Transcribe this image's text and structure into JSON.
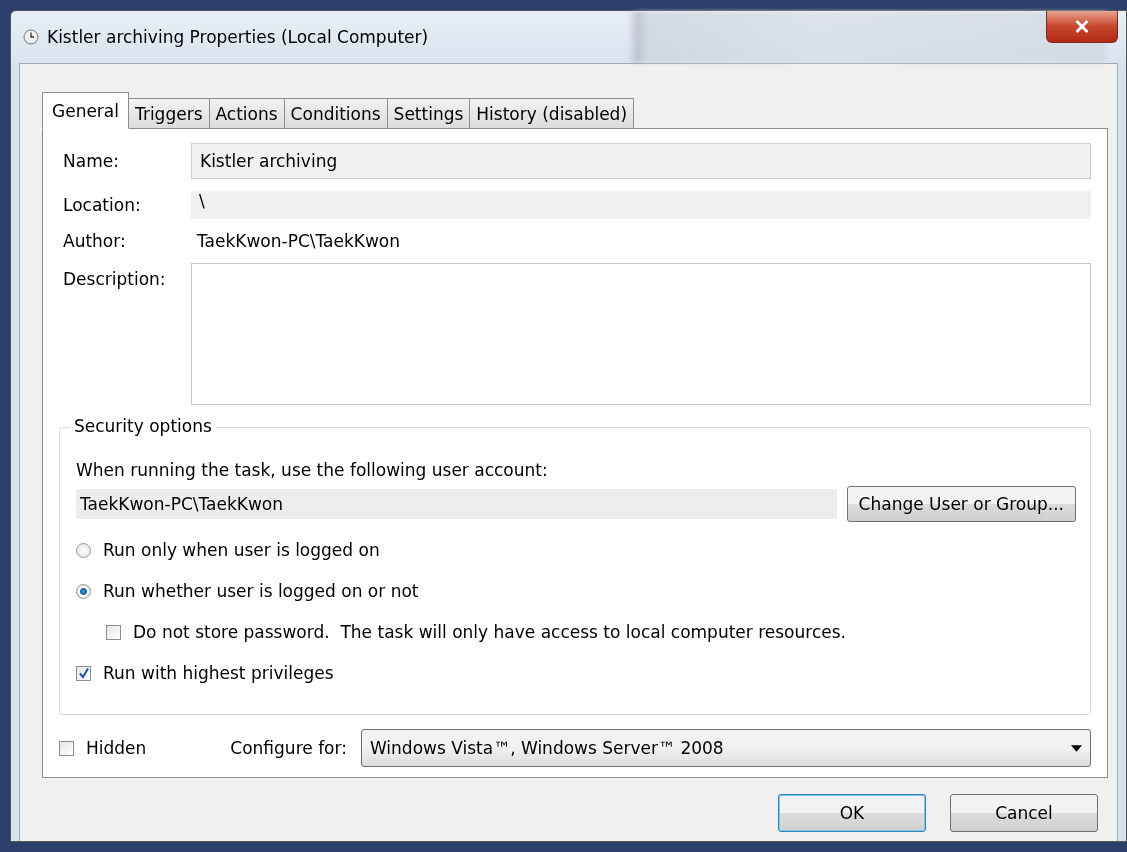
{
  "window": {
    "title": "Kistler archiving Properties (Local Computer)"
  },
  "tabs": [
    {
      "label": "General",
      "selected": true
    },
    {
      "label": "Triggers",
      "selected": false
    },
    {
      "label": "Actions",
      "selected": false
    },
    {
      "label": "Conditions",
      "selected": false
    },
    {
      "label": "Settings",
      "selected": false
    },
    {
      "label": "History (disabled)",
      "selected": false
    }
  ],
  "general": {
    "name": {
      "label": "Name:",
      "value": "Kistler archiving"
    },
    "location": {
      "label": "Location:",
      "value": "\\"
    },
    "author": {
      "label": "Author:",
      "value": "TaekKwon-PC\\TaekKwon"
    },
    "description": {
      "label": "Description:"
    }
  },
  "security": {
    "legend": "Security options",
    "prompt": "When running the task, use the following user account:",
    "account": "TaekKwon-PC\\TaekKwon",
    "change_button": "Change User or Group...",
    "run_options": [
      {
        "label": "Run only when user is logged on",
        "selected": false
      },
      {
        "label": "Run whether user is logged on or not",
        "selected": true
      }
    ],
    "do_not_store_password": {
      "label": "Do not store password.  The task will only have access to local computer resources.",
      "checked": false
    },
    "highest_privileges": {
      "label": "Run with highest privileges",
      "checked": true
    }
  },
  "hidden": {
    "label": "Hidden",
    "checked": false
  },
  "configure": {
    "label": "Configure for:",
    "value": "Windows Vista™, Windows Server™ 2008"
  },
  "buttons": [
    {
      "label": "OK",
      "default": true
    },
    {
      "label": "Cancel",
      "default": false
    }
  ]
}
